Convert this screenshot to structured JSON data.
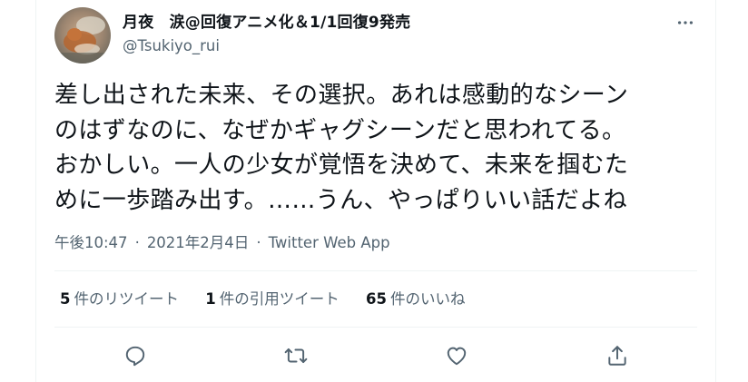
{
  "author": {
    "display_name": "月夜　涙@回復アニメ化＆1/1回復9発売",
    "handle": "@Tsukiyo_rui"
  },
  "tweet": {
    "text": "差し出された未来、その選択。あれは感動的なシーン\nのはずなのに、なぜかギャグシーンだと思われてる。\nおかしい。一人の少女が覚悟を決めて、未来を掴むた\nめに一歩踏み出す。……うん、やっぱりいい話だよね",
    "time": "午後10:47",
    "date": "2021年2月4日",
    "source": "Twitter Web App",
    "separator": "·"
  },
  "stats": {
    "retweets_count": "5",
    "retweets_label": "件のリツイート",
    "quotes_count": "1",
    "quotes_label": "件の引用ツイート",
    "likes_count": "65",
    "likes_label": "件のいいね"
  },
  "icons": {
    "more": "more-options-icon",
    "reply": "reply-icon",
    "retweet": "retweet-icon",
    "like": "like-icon",
    "share": "share-icon"
  },
  "colors": {
    "text": "#0f1419",
    "secondary": "#536471",
    "divider": "#eff3f4"
  }
}
